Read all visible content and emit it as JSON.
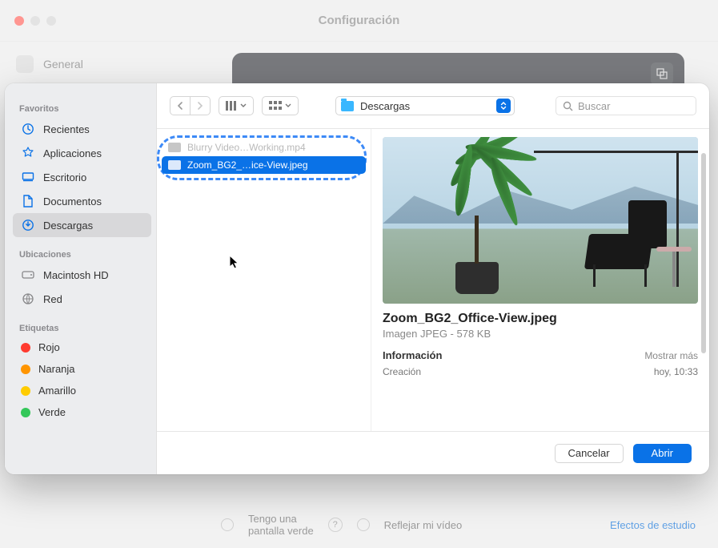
{
  "bg": {
    "title": "Configuración",
    "sidebar_general": "General",
    "greenscreen_line1": "Tengo una",
    "greenscreen_line2": "pantalla verde",
    "mirror": "Reflejar mi vídeo",
    "studio": "Efectos de estudio"
  },
  "sidebar": {
    "section_fav": "Favoritos",
    "items_fav": [
      {
        "label": "Recientes"
      },
      {
        "label": "Aplicaciones"
      },
      {
        "label": "Escritorio"
      },
      {
        "label": "Documentos"
      },
      {
        "label": "Descargas",
        "selected": true
      }
    ],
    "section_loc": "Ubicaciones",
    "items_loc": [
      {
        "label": "Macintosh HD"
      },
      {
        "label": "Red"
      }
    ],
    "section_tags": "Etiquetas",
    "tags": [
      {
        "label": "Rojo",
        "color": "#ff3b30"
      },
      {
        "label": "Naranja",
        "color": "#ff9500"
      },
      {
        "label": "Amarillo",
        "color": "#ffcc00"
      },
      {
        "label": "Verde",
        "color": "#34c759"
      }
    ]
  },
  "toolbar": {
    "location": "Descargas",
    "search_placeholder": "Buscar"
  },
  "files": [
    {
      "name": "Blurry Video…Working.mp4"
    },
    {
      "name": "Zoom_BG2_…ice-View.jpeg",
      "selected": true
    }
  ],
  "preview": {
    "filename": "Zoom_BG2_Office-View.jpeg",
    "kind": "Imagen JPEG - 578 KB",
    "info_label": "Información",
    "more_label": "Mostrar más",
    "meta_key": "Creación",
    "meta_val": "hoy, 10:33"
  },
  "footer": {
    "cancel": "Cancelar",
    "open": "Abrir"
  }
}
